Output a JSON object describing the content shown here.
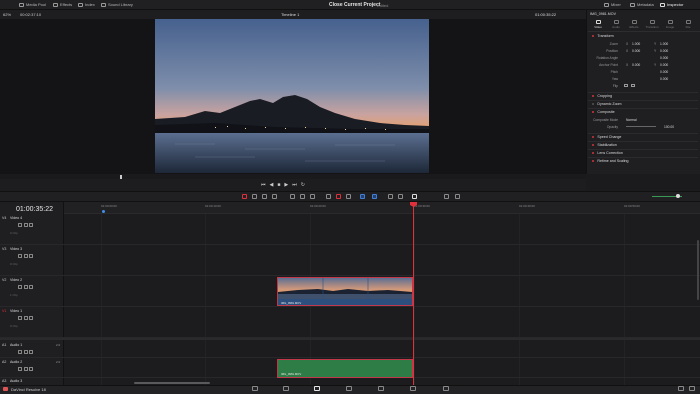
{
  "topbar": {
    "left_items": [
      "Media Pool",
      "Effects",
      "Index",
      "Sound Library"
    ],
    "project_title": "Close Current Project",
    "project_status": "Edited",
    "right_items": [
      "Mixer",
      "Metadata",
      "Inspector"
    ]
  },
  "viewer": {
    "zoom": "62%",
    "source_timecode": "00:02:37:10",
    "timeline_name": "Timeline 1",
    "record_timecode": "01:00:35:22"
  },
  "inspector": {
    "clip_name": "IMG_0981.MOV",
    "tabs": [
      "Video",
      "Audio",
      "Effects",
      "Transition",
      "Image",
      "File"
    ],
    "active_tab": "Video",
    "sections": {
      "transform": "Transform",
      "cropping": "Cropping",
      "dynamic_zoom": "Dynamic Zoom",
      "composite": "Composite",
      "speed_change": "Speed Change",
      "stabilization": "Stabilization",
      "lens_correction": "Lens Correction",
      "retime_scaling": "Retime and Scaling"
    },
    "transform": {
      "zoom_label": "Zoom",
      "zoom_x_label": "X",
      "zoom_x": "1.000",
      "zoom_y_label": "Y",
      "zoom_y": "1.000",
      "position_label": "Position",
      "position_x_label": "X",
      "position_x": "0.000",
      "position_y_label": "Y",
      "position_y": "0.000",
      "rotation_label": "Rotation Angle",
      "rotation": "0.000",
      "anchor_label": "Anchor Point",
      "anchor_x_label": "X",
      "anchor_x": "0.000",
      "anchor_y_label": "Y",
      "anchor_y": "0.000",
      "pitch_label": "Pitch",
      "pitch": "0.000",
      "yaw_label": "Yaw",
      "yaw": "0.000",
      "flip_label": "Flip"
    },
    "composite": {
      "mode_label": "Composite Mode",
      "mode": "Normal",
      "opacity_label": "Opacity",
      "opacity": "100.00"
    }
  },
  "timeline": {
    "timecode": "01:00:35:22",
    "ruler_ticks": [
      "01:00:00:00",
      "01:00:10:00",
      "01:00:20:00",
      "01:00:30:00",
      "01:00:40:00",
      "01:00:50:00"
    ],
    "tracks": [
      {
        "id": "V4",
        "name": "Video 4",
        "sub": "0 Clip"
      },
      {
        "id": "V3",
        "name": "Video 3",
        "sub": "0 Clip"
      },
      {
        "id": "V2",
        "name": "Video 2",
        "sub": "1 Clip"
      },
      {
        "id": "V1",
        "name": "Video 1",
        "sub": "0 Clip"
      },
      {
        "id": "A1",
        "name": "Audio 1",
        "channel": "2.0"
      },
      {
        "id": "A2",
        "name": "Audio 2",
        "channel": "2.0"
      },
      {
        "id": "A3",
        "name": "Audio 3",
        "channel": "2.0"
      }
    ],
    "video_clip_label": "IMG_0981.MOV",
    "audio_clip_label": "IMG_0981.MOV"
  },
  "app": {
    "name": "DaVinci Resolve 18"
  },
  "colors": {
    "accent_red": "#e0303c",
    "video_clip": "#2c4f7e",
    "audio_clip": "#2f7d46"
  }
}
